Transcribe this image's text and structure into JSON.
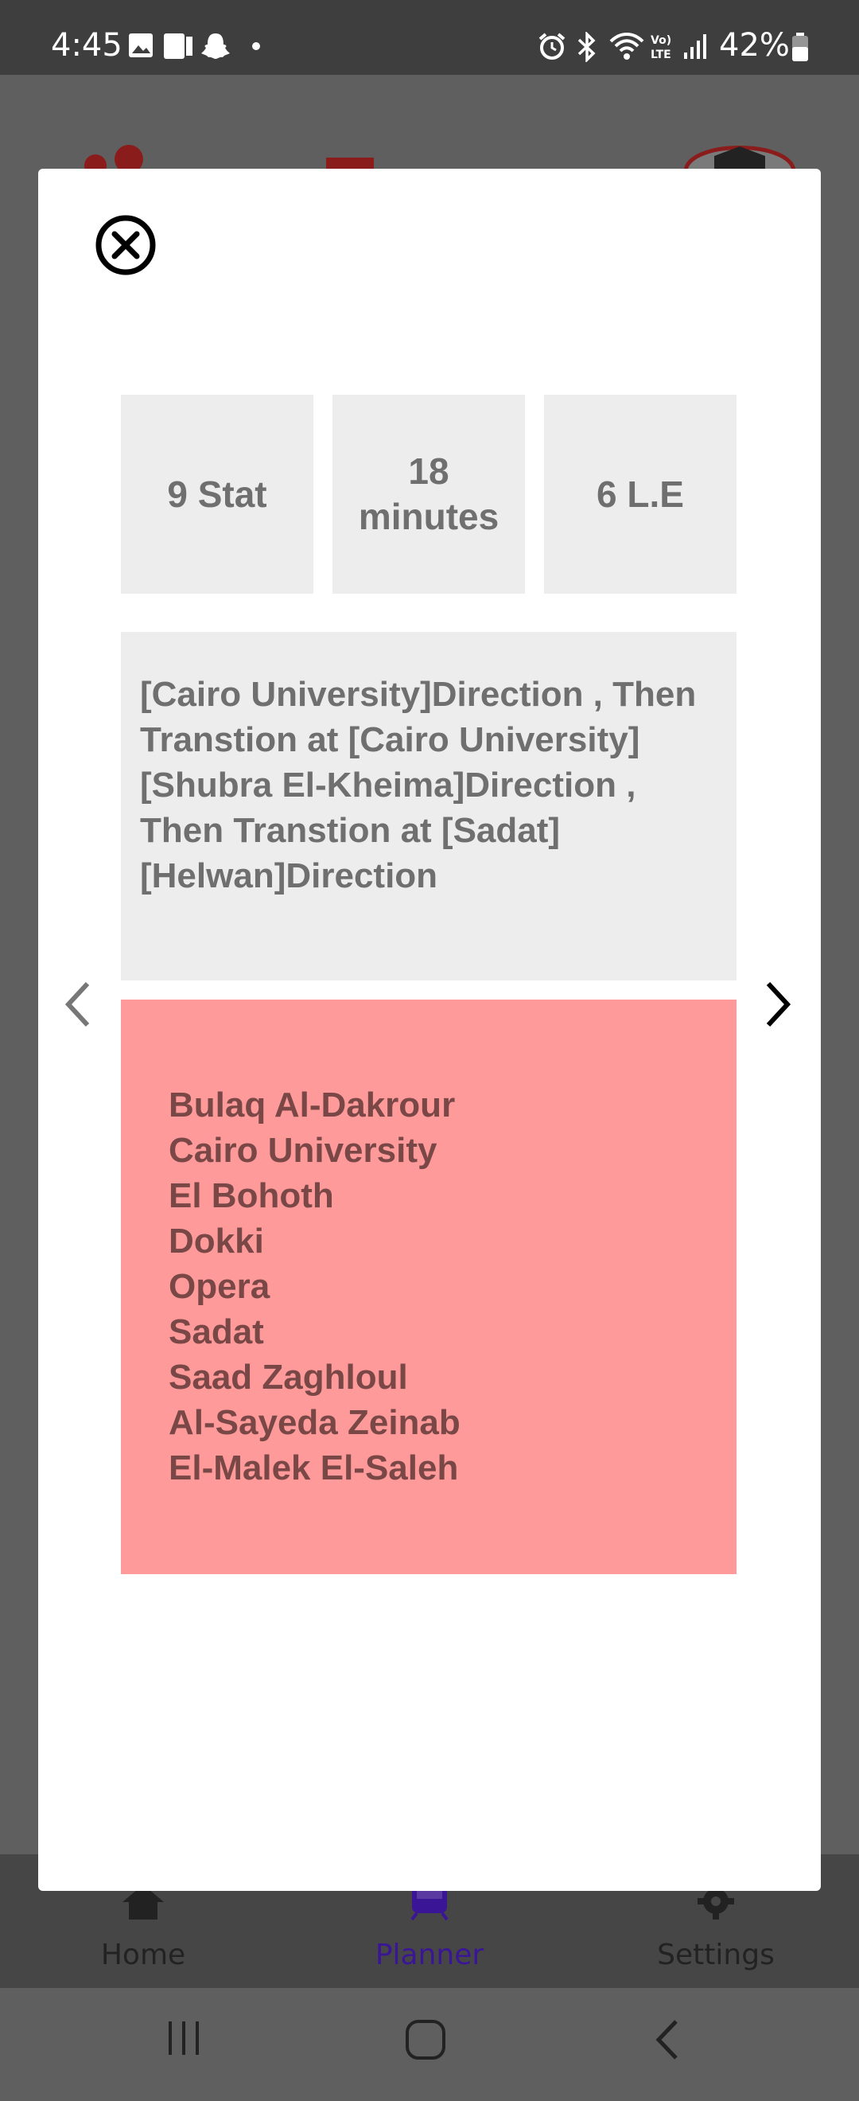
{
  "status_bar": {
    "time": "4:45",
    "battery": "42%",
    "icons": [
      "image-icon",
      "sim-card-icon",
      "snapchat-icon",
      "dot-icon",
      "alarm-icon",
      "bluetooth-icon",
      "wifi-icon",
      "volte-icon",
      "signal-icon",
      "battery-icon"
    ]
  },
  "background_nav": {
    "items": [
      {
        "label": "Home",
        "icon": "home-icon"
      },
      {
        "label": "Planner",
        "icon": "train-icon"
      },
      {
        "label": "Settings",
        "icon": "gear-icon"
      }
    ]
  },
  "modal": {
    "stats": {
      "stations": "9 Stat",
      "time_line1": "18",
      "time_line2": "minutes",
      "price": "6 L.E"
    },
    "directions": {
      "lines": [
        "[Cairo University]Direction , Then",
        "Transtion at [Cairo University]",
        "[Shubra El-Kheima]Direction ,",
        "Then Transtion at [Sadat]",
        "[Helwan]Direction"
      ]
    },
    "stations": [
      "Bulaq Al-Dakrour",
      "Cairo University",
      "El Bohoth",
      "Dokki",
      "Opera",
      "Sadat",
      "Saad Zaghloul",
      "Al-Sayeda Zeinab",
      "El-Malek El-Saleh"
    ]
  },
  "colors": {
    "stat_box_bg": "#ededed",
    "stations_bg": "#ff9a9a",
    "stations_text": "#7a4747",
    "active_nav": "#3a1596"
  }
}
